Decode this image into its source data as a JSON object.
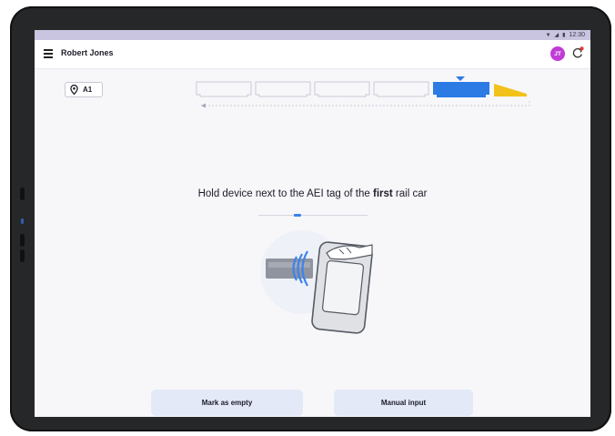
{
  "status_bar": {
    "time": "12:30"
  },
  "header": {
    "user_name": "Robert Jones",
    "avatar_initials": "JT"
  },
  "location": {
    "label": "A1"
  },
  "train": {
    "empty_cars": 4,
    "active_car_color": "#2c7be5",
    "locomotive_color": "#f2c21b"
  },
  "instruction": {
    "before": "Hold device next to the AEI tag of the ",
    "emphasis": "first",
    "after": " rail car"
  },
  "progress": {
    "fraction": 0.35
  },
  "actions": {
    "mark_empty_label": "Mark as empty",
    "manual_input_label": "Manual input"
  },
  "colors": {
    "accent": "#3c82f0",
    "avatar": "#c13bd6",
    "status_bar": "#c9c4df",
    "button_bg": "#e4e9f8"
  }
}
